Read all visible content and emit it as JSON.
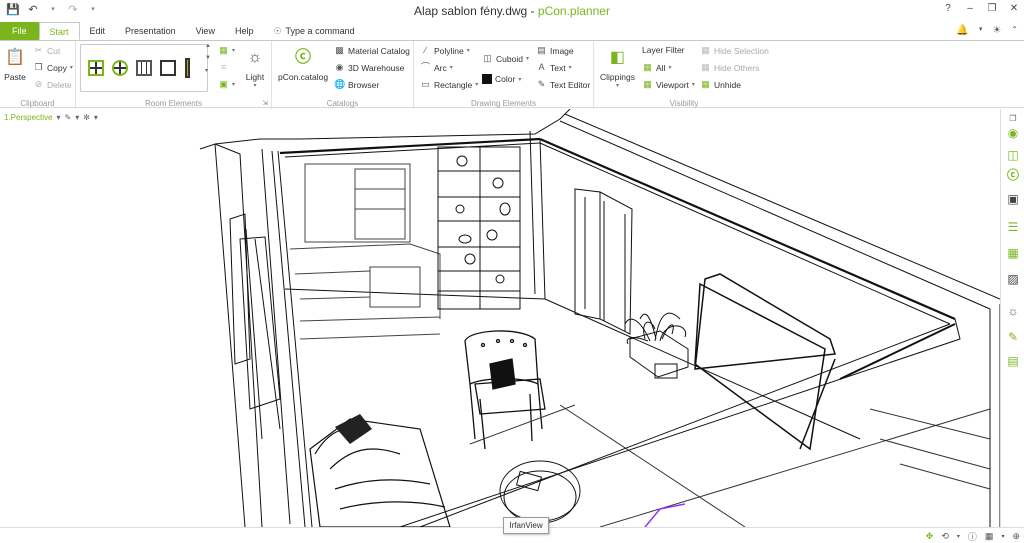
{
  "titlebar": {
    "document_title": "Alap sablon fény.dwg",
    "separator": " - ",
    "app_name": "pCon.planner"
  },
  "tabs": [
    "File",
    "Start",
    "Edit",
    "Presentation",
    "View",
    "Help"
  ],
  "tell_me": "Type a command",
  "clipboard": {
    "paste": "Paste",
    "cut": "Cut",
    "copy": "Copy",
    "delete": "Delete",
    "label": "Clipboard"
  },
  "room_elements": {
    "light": "Light",
    "label": "Room Elements"
  },
  "catalogs": {
    "pcon_catalog": "pCon.catalog",
    "material_catalog": "Material Catalog",
    "warehouse": "3D Warehouse",
    "browser": "Browser",
    "label": "Catalogs"
  },
  "drawing": {
    "polyline": "Polyline",
    "arc": "Arc",
    "rectangle": "Rectangle",
    "cuboid": "Cuboid",
    "color": "Color",
    "image": "Image",
    "text": "Text",
    "text_editor": "Text Editor",
    "label": "Drawing Elements"
  },
  "visibility": {
    "clippings": "Clippings",
    "layer_filter": "Layer Filter",
    "all": "All",
    "viewport": "Viewport",
    "hide_selection": "Hide Selection",
    "hide_others": "Hide Others",
    "unhide": "Unhide",
    "label": "Visibility"
  },
  "viewport_label": "1.Perspective",
  "tooltip": "IrfanView",
  "colors": {
    "accent": "#7ab51d"
  }
}
